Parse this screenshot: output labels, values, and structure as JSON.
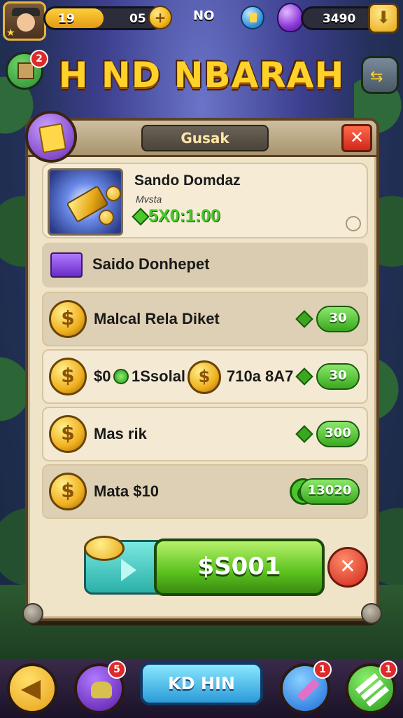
{
  "hud": {
    "level": "19",
    "coins": "05",
    "label": "NO",
    "gems": "3490"
  },
  "title": "H ND NBARAH",
  "badges": {
    "map": "2",
    "bag": "5",
    "pencil": "1",
    "list": "1"
  },
  "panel": {
    "tab_label": "Gusak",
    "close_label": "✕",
    "featured": {
      "title": "Sando Domdaz",
      "subtitle": "Mvsta",
      "price": "5X0:1:00"
    },
    "category_label": "Saido Donhepet",
    "items": [
      {
        "label": "Malcal Rela Diket",
        "price": "30"
      },
      {
        "label": "$0",
        "label_mid": "1Ssolal",
        "label_right": "710a 8A7",
        "price": "30"
      },
      {
        "label": "Mas rik",
        "price": "300"
      },
      {
        "label": "Mata $10",
        "price": "13020"
      }
    ],
    "buy_label": "$S001",
    "cancel_label": "✕"
  },
  "bottom_nav": {
    "center_label": "KD HIN"
  },
  "colors": {
    "accent_gold": "#ffd22a",
    "buy_green": "#5ac21e",
    "close_red": "#d0281a",
    "panel_bg": "#efe3c8"
  },
  "icons": [
    "avatar-icon",
    "coin-icon",
    "blue-gem-icon",
    "purple-gem-icon",
    "shield-icon",
    "map-icon",
    "swap-icon",
    "scroll-icon",
    "gold-bar-icon",
    "box-icon",
    "cash-icon",
    "back-icon",
    "bag-icon",
    "pencil-icon",
    "list-icon"
  ]
}
